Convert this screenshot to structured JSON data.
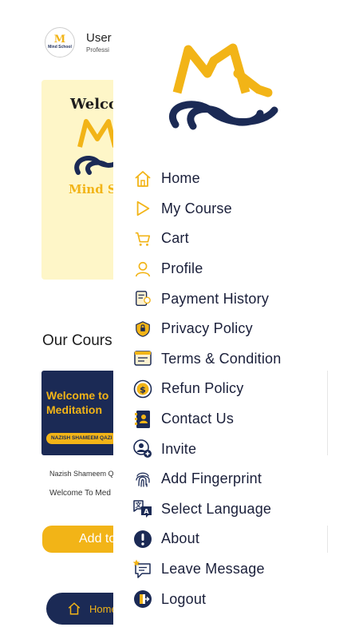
{
  "background": {
    "user": {
      "name": "User",
      "role": "Professi",
      "avatar_mark": "M",
      "avatar_text": "Mind School"
    },
    "hero": {
      "title": "Welco",
      "caption": "Mind S"
    },
    "courses_heading": "Our Cours",
    "course_card": {
      "title_line1": "Welcome to",
      "title_line2": "Meditation",
      "badge": "NAZISH SHAMEEM QAZI"
    },
    "course_author": "Nazish Shameem Qa",
    "course_name": "Welcome To Med",
    "add_button": "Add to",
    "bottom_nav": {
      "label": "Home"
    }
  },
  "drawer": {
    "logo": "mind-school-logo",
    "menu": [
      {
        "label": "Home",
        "icon": "home-icon"
      },
      {
        "label": "My Course",
        "icon": "play-icon"
      },
      {
        "label": "Cart",
        "icon": "cart-icon"
      },
      {
        "label": "Profile",
        "icon": "user-icon"
      },
      {
        "label": "Payment History",
        "icon": "payment-history-icon"
      },
      {
        "label": "Privacy Policy",
        "icon": "shield-icon"
      },
      {
        "label": "Terms & Condition",
        "icon": "document-icon"
      },
      {
        "label": "Refun Policy",
        "icon": "refund-icon"
      },
      {
        "label": "Contact Us",
        "icon": "contact-book-icon"
      },
      {
        "label": "Invite",
        "icon": "invite-user-icon"
      },
      {
        "label": "Add Fingerprint",
        "icon": "fingerprint-icon"
      },
      {
        "label": "Select Language",
        "icon": "language-icon"
      },
      {
        "label": "About",
        "icon": "info-icon"
      },
      {
        "label": "Leave Message",
        "icon": "message-icon"
      },
      {
        "label": "Logout",
        "icon": "logout-icon"
      }
    ]
  },
  "colors": {
    "accent": "#f2b417",
    "navy": "#1b2a55",
    "hero_bg": "#fef6c8"
  }
}
